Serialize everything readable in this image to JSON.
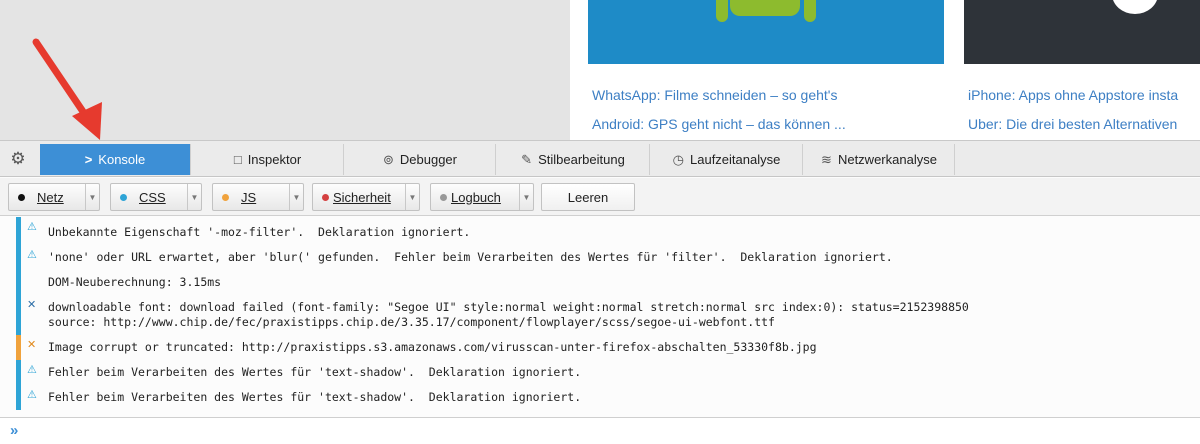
{
  "webpage": {
    "articles_left": [
      "WhatsApp: Filme schneiden – so geht's",
      "Android: GPS geht nicht – das können ..."
    ],
    "articles_right": [
      "iPhone: Apps ohne Appstore insta",
      "Uber: Die drei besten Alternativen"
    ]
  },
  "devtools": {
    "tabs": [
      {
        "label": "Konsole",
        "icon": ">"
      },
      {
        "label": "Inspektor",
        "icon": "□"
      },
      {
        "label": "Debugger",
        "icon": "⊚"
      },
      {
        "label": "Stilbearbeitung",
        "icon": "✎"
      },
      {
        "label": "Laufzeitanalyse",
        "icon": "◷"
      },
      {
        "label": "Netzwerkanalyse",
        "icon": "≋"
      }
    ],
    "filters": {
      "netz": "Netz",
      "css": "CSS",
      "js": "JS",
      "sicherheit": "Sicherheit",
      "logbuch": "Logbuch",
      "leeren": "Leeren"
    },
    "filter_colors": {
      "netz": "#111111",
      "css": "#2ea4d6",
      "js": "#f0a23c",
      "sicherheit": "#d44040",
      "logbuch": "#999999"
    },
    "log": [
      {
        "type": "css",
        "icon": "⚠",
        "lines": [
          "Unbekannte Eigenschaft '-moz-filter'.  Deklaration ignoriert."
        ]
      },
      {
        "type": "css",
        "icon": "⚠",
        "lines": [
          "'none' oder URL erwartet, aber 'blur(' gefunden.  Fehler beim Verarbeiten des Wertes für 'filter'.  Deklaration ignoriert."
        ]
      },
      {
        "type": "css",
        "icon": "",
        "lines": [
          "DOM-Neuberechnung: 3.15ms"
        ]
      },
      {
        "type": "net",
        "icon": "✕",
        "lines": [
          "downloadable font: download failed (font-family: \"Segoe UI\" style:normal weight:normal stretch:normal src index:0): status=2152398850",
          "source: http://www.chip.de/fec/praxistipps.chip.de/3.35.17/component/flowplayer/scss/segoe-ui-webfont.ttf"
        ]
      },
      {
        "type": "sec",
        "icon": "✕",
        "lines": [
          "Image corrupt or truncated: http://praxistipps.s3.amazonaws.com/virusscan-unter-firefox-abschalten_53330f8b.jpg"
        ]
      },
      {
        "type": "css",
        "icon": "⚠",
        "lines": [
          "Fehler beim Verarbeiten des Wertes für 'text-shadow'.  Deklaration ignoriert."
        ]
      },
      {
        "type": "css",
        "icon": "⚠",
        "lines": [
          "Fehler beim Verarbeiten des Wertes für 'text-shadow'.  Deklaration ignoriert."
        ]
      }
    ],
    "prompt": "»"
  }
}
